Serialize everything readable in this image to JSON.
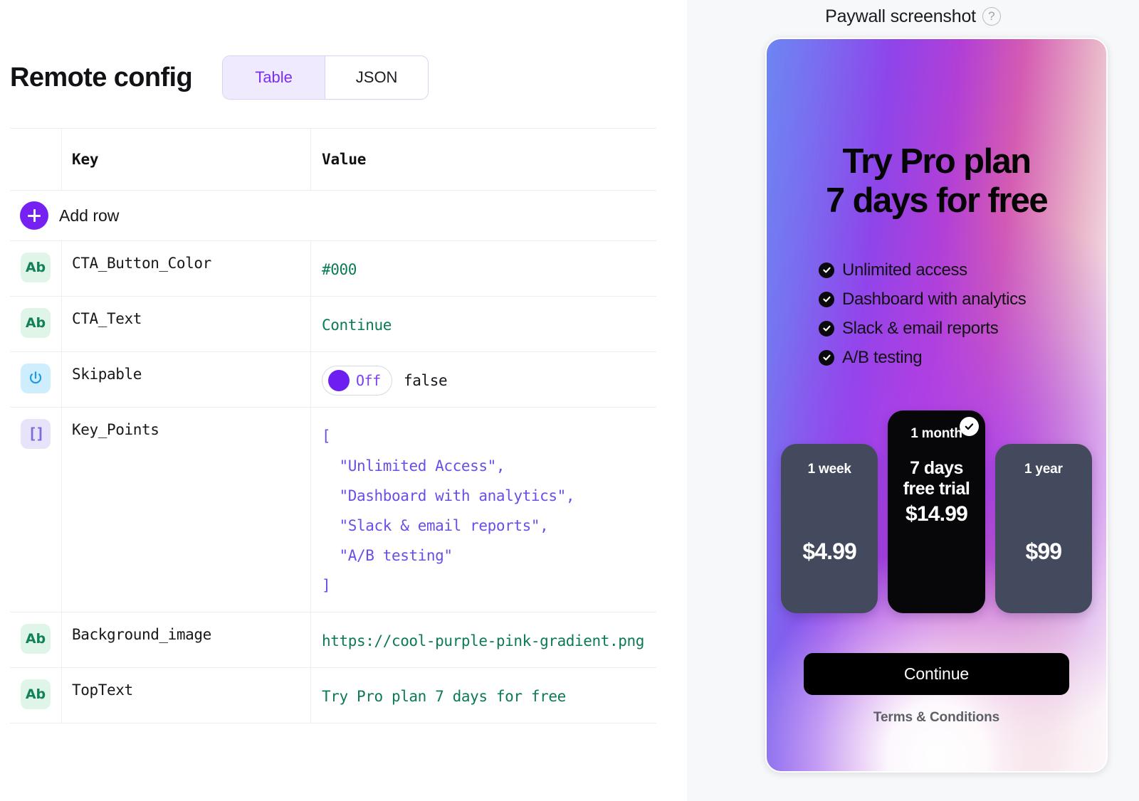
{
  "left": {
    "page_title": "Remote config",
    "view_tabs": [
      {
        "label": "Table",
        "active": true
      },
      {
        "label": "JSON",
        "active": false
      }
    ],
    "table": {
      "columns": {
        "key": "Key",
        "value": "Value"
      },
      "add_row_label": "Add row",
      "rows": [
        {
          "type_icon": "string-type-icon",
          "type_label": "Ab",
          "key": "CTA_Button_Color",
          "value": "#000",
          "value_kind": "string"
        },
        {
          "type_icon": "string-type-icon",
          "type_label": "Ab",
          "key": "CTA_Text",
          "value": "Continue",
          "value_kind": "string"
        },
        {
          "type_icon": "boolean-type-icon",
          "type_label": "",
          "key": "Skipable",
          "value": "false",
          "value_kind": "boolean",
          "toggle_label": "Off",
          "toggle_state": "off"
        },
        {
          "type_icon": "array-type-icon",
          "type_label": "[]",
          "key": "Key_Points",
          "value": "[\n  \"Unlimited Access\",\n  \"Dashboard with analytics\",\n  \"Slack & email reports\",\n  \"A/B testing\"\n]",
          "value_kind": "json"
        },
        {
          "type_icon": "string-type-icon",
          "type_label": "Ab",
          "key": "Background_image",
          "value": "https://cool-purple-pink-gradient.png",
          "value_kind": "string"
        },
        {
          "type_icon": "string-type-icon",
          "type_label": "Ab",
          "key": "TopText",
          "value": "Try Pro plan 7 days for free",
          "value_kind": "string"
        }
      ]
    }
  },
  "right": {
    "panel_title": "Paywall screenshot",
    "help_glyph": "?",
    "paywall": {
      "headline": "Try Pro plan\n7 days for free",
      "features": [
        "Unlimited access",
        "Dashboard with analytics",
        "Slack & email reports",
        "A/B testing"
      ],
      "plans": [
        {
          "period": "1 week",
          "price": "$4.99",
          "trial": "",
          "selected": false
        },
        {
          "period": "1 month",
          "price": "$14.99",
          "trial": "7 days\nfree trial",
          "selected": true
        },
        {
          "period": "1 year",
          "price": "$99",
          "trial": "",
          "selected": false
        }
      ],
      "cta_label": "Continue",
      "terms_label": "Terms & Conditions"
    }
  },
  "colors": {
    "accent_purple": "#7521f2",
    "tab_active_bg": "#efeafd",
    "tab_active_text": "#7a2ff2",
    "string_value": "#0b7a55",
    "json_value": "#6c4de6",
    "cta_black": "#000000",
    "plan_slate": "#444a5e",
    "plan_selected": "#070709"
  }
}
